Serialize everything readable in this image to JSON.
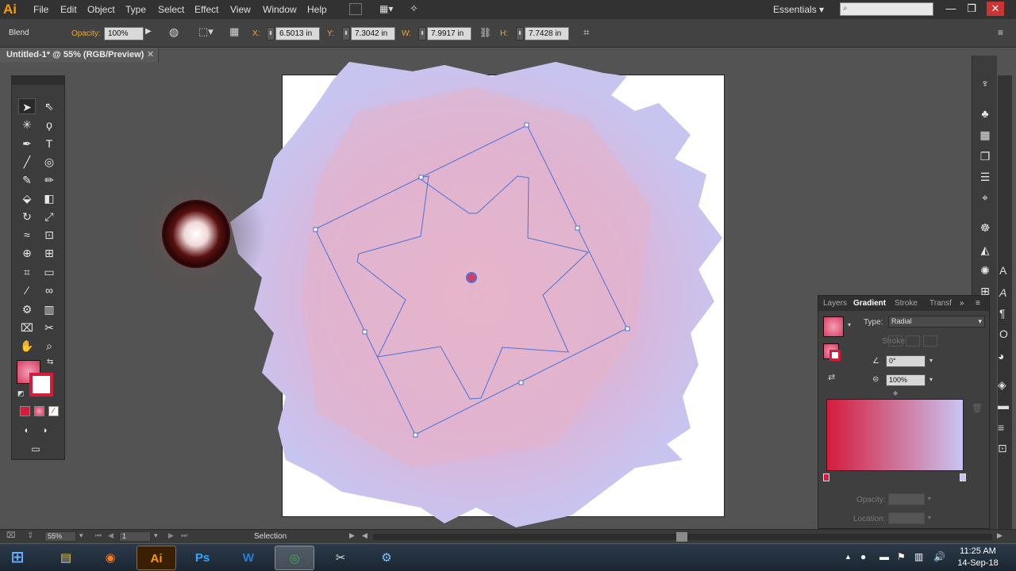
{
  "app": {
    "logo": "Ai",
    "workspace": "Essentials",
    "accent_color": "#ff9a00"
  },
  "menu": {
    "items": [
      "File",
      "Edit",
      "Object",
      "Type",
      "Select",
      "Effect",
      "View",
      "Window",
      "Help"
    ]
  },
  "window_controls": {
    "minimize": "—",
    "maximize": "❐",
    "close": "✕"
  },
  "control_bar": {
    "selection_type": "Blend",
    "opacity_label": "Opacity:",
    "opacity_value": "100%",
    "x_label": "X:",
    "x_value": "6.5013 in",
    "y_label": "Y:",
    "y_value": "7.3042 in",
    "w_label": "W:",
    "w_value": "7.9917 in",
    "h_label": "H:",
    "h_value": "7.7428 in"
  },
  "document": {
    "tab_title": "Untitled-1* @ 55% (RGB/Preview)",
    "close": "✕"
  },
  "gradient_panel": {
    "tabs": [
      "Layers",
      "Gradient",
      "Stroke",
      "Transf"
    ],
    "active_tab": "Gradient",
    "type_label": "Type:",
    "type_value": "Radial",
    "stroke_label": "Stroke:",
    "angle_value": "0°",
    "aspect_value": "100%",
    "opacity_label": "Opacity:",
    "location_label": "Location:",
    "gradient_start_color": "#d41c3c",
    "gradient_end_color": "#c9c5f2"
  },
  "status": {
    "zoom": "55%",
    "page": "1",
    "tool": "Selection"
  },
  "taskbar": {
    "apps": [
      {
        "label": "⊞",
        "name": "start"
      },
      {
        "label": "▤",
        "name": "file-explorer"
      },
      {
        "label": "◉",
        "name": "firefox"
      },
      {
        "label": "Ai",
        "name": "illustrator"
      },
      {
        "label": "Ps",
        "name": "photoshop"
      },
      {
        "label": "W",
        "name": "word"
      },
      {
        "label": "◎",
        "name": "chrome"
      },
      {
        "label": "✂",
        "name": "snipping-tool"
      },
      {
        "label": "⚙",
        "name": "tool-app"
      }
    ],
    "time": "11:25 AM",
    "date": "14-Sep-18"
  }
}
